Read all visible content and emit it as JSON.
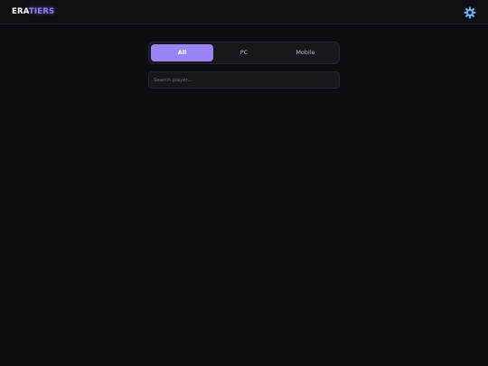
{
  "header": {
    "logo_part1": "ERA",
    "logo_part2": "TIERS",
    "settings_icon": "gear-icon"
  },
  "tabs": [
    {
      "label": "All",
      "active": true
    },
    {
      "label": "PC",
      "active": false
    },
    {
      "label": "Mobile",
      "active": false
    }
  ],
  "search": {
    "placeholder": "Search player...",
    "value": ""
  },
  "colors": {
    "background": "#0d0e11",
    "accent": "#9a83f7",
    "logo_accent": "#8f78f2",
    "gear": "#6fa8e8"
  }
}
